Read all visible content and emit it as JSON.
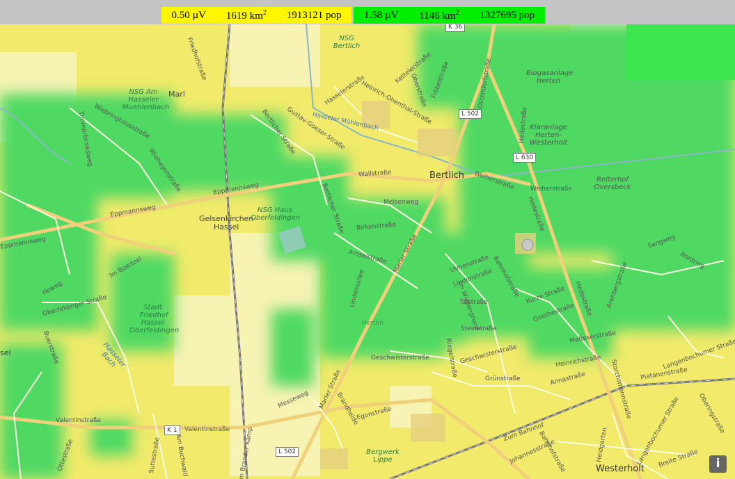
{
  "legend": {
    "yellow": {
      "signal": "0.50 µV",
      "area": "1619 km",
      "area_sup": "2",
      "pop": "1913121 pop",
      "color": "#fff700"
    },
    "green": {
      "signal": "1.58 µV",
      "area": "1146 km",
      "area_sup": "2",
      "pop": "1327695 pop",
      "color": "#00ee00"
    }
  },
  "map": {
    "places": {
      "bertlich": "Bertlich",
      "hassel_1": "Gelsenkirchen-",
      "hassel_2": "Hassel",
      "westerholt": "Westerholt",
      "marl": "Marl",
      "hassel_left": "sel"
    },
    "nature": {
      "nsg_am": "NSG Am Hasseler Muehlenbach",
      "nsg_bertlich": "NSG Bertlich",
      "nsg_haus": "NSG Haus Oberfeldingen",
      "friedhof": "Stadt. Friedhof Hassel-Oberfeldingen",
      "biogas": "Biogasanlage Herten",
      "klaranlage": "Klaranlage Herten-Westerholt",
      "reiterhof": "Reiterhof Oversbeck",
      "bergwerk": "Bergwerk Lippe",
      "hasseler_bach": "Hasseler Bach"
    },
    "road_badges": {
      "k36": "K 36",
      "l502_top": "L 502",
      "l630": "L 630",
      "k1": "K 1",
      "l502_bottom": "L 502"
    },
    "streets": {
      "wallstrasse": "Wallstraße",
      "eppmannsweg_1": "Eppmannsweg",
      "eppmannsweg_2": "Eppmannsweg",
      "eppmannsweg_3": "Eppmannsweg",
      "marler_1": "Marler Straße",
      "marler_2": "Marler Straße",
      "hedestrasse_1": "Hedestraße",
      "hedestrasse_2": "Hedestraße",
      "hedestrasse_3": "Hedestraße",
      "valentinstrasse_1": "Valentinstraße",
      "valentinstrasse_2": "Valentinstraße",
      "weiherstrasse_1": "Weiherstraße",
      "weiherstrasse_2": "Weiherstraße",
      "meisenweg": "Meisenweg",
      "birkenstrasse": "Birkenstraße",
      "amselstrasse": "Amselstraße",
      "ulmenstrasse": "Ulmenstraße",
      "lindenstrasse": "Lindenstraße",
      "bahnhofstrasse_1": "Bahnhofstraße",
      "bahnhofstrasse_2": "Bahnhofstraße",
      "geschwisterstrasse_1": "Geschwisterstraße",
      "geschwisterstrasse_2": "Geschwisterstraße",
      "grunstrasse": "Grünstraße",
      "annastrasse": "Annastraße",
      "heinrichstrasse": "Heinrichstraße",
      "malteserstrasse": "Malteserstraße",
      "kurzestrasse": "Kurze Straße",
      "goethestrasse": "Goethestraße",
      "platanenstrasse": "Platanenstraße",
      "langenbochumer_1": "Langenbochumer Straße",
      "langenbochumer_2": "Langenbochumer Straße",
      "breite_strasse": "Breite Straße",
      "zum_bahnhof": "Zum Bahnhof",
      "egonstrasse": "Egonstraße",
      "brandheide": "Brandheide",
      "messeweg": "Messeweg",
      "am_buchwald": "Am Buchwald",
      "suttestrasse": "Suttestraße",
      "am_brander_kamp": "Am Brander Kamp",
      "ottestrasse": "Ottestraße",
      "im_boertzel": "Im Boertzel",
      "hasseler_muehlenbach": "Hasseler Mühlenbach",
      "gustav_goeser": "Gustav-Goeser-Straße",
      "bertlicher_1": "Bertlicher Straße",
      "bertlicher_2": "Bertlicher Straße",
      "hasselerstrasse": "Hasselerstraße",
      "friedhofstrasse": "Friedhofstraße",
      "frobelstrasse": "Fröbelstraße",
      "heinrich_ohenthal": "Heinrich-Ohenthal-Straße",
      "kettelerstrasse": "Kettelerstraße",
      "oberstrasse": "Oberstraße",
      "ostendorfstrasse": "Ostendorfstraße",
      "timmerbrinksweg": "Timmerbrinksweg",
      "wiebringhausstrasse": "Wiebringhausstraße",
      "wiehagenstrasse": "Wiehagenstraße",
      "buerstrasse": "Buerstraße",
      "oberfeldinger": "Oberfeldinger Straße",
      "howeg": "Howeg",
      "taistrasse": "Taistraße",
      "steinstrasse": "Steinstraße",
      "im_wiesengrund": "Im Wiesengrund",
      "riegelstrasse": "Riegelstraße",
      "arenbergstrasse": "Arenbergstraße",
      "nordring": "Nordring",
      "sangweg": "Sangweg",
      "oberingstrasse": "Oberingstraße",
      "heidgarten": "Heidgarten",
      "johannesstrasse": "Johannesstraße",
      "storchsmannstrasse": "Storchsmannstraße",
      "lindensallee": "Lindensallee",
      "herten": "Herten"
    },
    "info_button": "i"
  }
}
